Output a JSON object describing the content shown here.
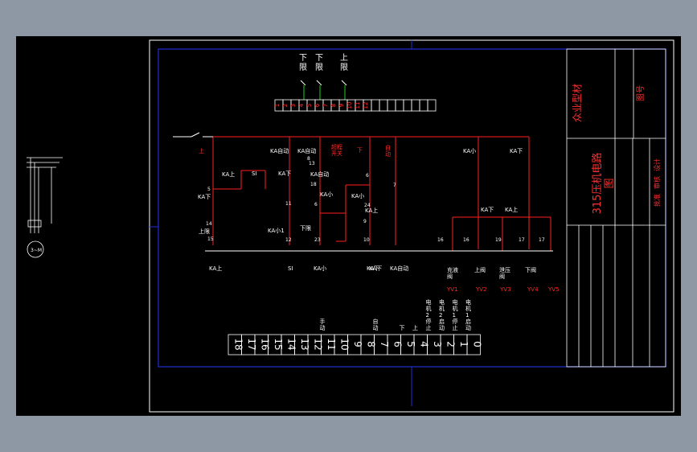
{
  "colors": {
    "background": "#8e97a4",
    "canvas": "#000000",
    "frame": "#ffffff",
    "border": "#1f2fd6",
    "wire": "#ff2020",
    "text": "#ffffff",
    "terminal_num": "#ff3030",
    "label_red": "#ff2a2a"
  },
  "top_switches": [
    {
      "label": "下\n限"
    },
    {
      "label": "下\n限"
    },
    {
      "label": "上\n限"
    }
  ],
  "top_terminals": [
    "1",
    "2",
    "3",
    "4",
    "5",
    "6",
    "7",
    "8",
    "9",
    "10",
    "11",
    "12",
    "",
    "",
    "",
    "",
    "",
    "",
    "",
    ""
  ],
  "bottom_terminals": [
    "18",
    "17",
    "16",
    "15",
    "14",
    "13",
    "12",
    "11",
    "10",
    "9",
    "8",
    "7",
    "6",
    "5",
    "4",
    "3",
    "2",
    "1",
    "0"
  ],
  "bottom_terminal_labels": [
    {
      "text": "手\n动",
      "slot": 11
    },
    {
      "text": "自\n动",
      "slot": 7
    },
    {
      "text": "下",
      "slot": 5
    },
    {
      "text": "上",
      "slot": 4
    },
    {
      "text": "电\n机\n2\n停\n止",
      "slot": 3
    },
    {
      "text": "电\n机\n2\n启\n动",
      "slot": 2
    },
    {
      "text": "电\n机\n1\n停\n止",
      "slot": 1
    },
    {
      "text": "电\n机\n1\n启\n动",
      "slot": 0
    }
  ],
  "circuit_labels": [
    "上",
    "KA上",
    "SI",
    "KA下",
    "上限",
    "KA自动",
    "KA自动",
    "KA下",
    "KA小1",
    "下限",
    "KA小",
    "KA上",
    "KA小",
    "KA自动",
    "下",
    "自\n动",
    "KA下",
    "KA小",
    "KA下",
    "KA上",
    "KA下",
    "KA上",
    "SI",
    "KA小",
    "KA下",
    "KA自动",
    "充液\n阀",
    "上阀",
    "泄压\n阀",
    "下阀",
    "超程\n开关",
    "YV1",
    "YV2",
    "YV3",
    "YV4",
    "YV5"
  ],
  "wire_numbers": [
    "5",
    "14",
    "15",
    "8",
    "11",
    "12",
    "13",
    "18",
    "6",
    "23",
    "6",
    "24",
    "9",
    "10",
    "7",
    "16",
    "16",
    "19",
    "17",
    "17"
  ],
  "title_block": {
    "company": "众业型材",
    "drawing_title": "315压机电路\n图",
    "doc_no": "图号",
    "rows": [
      "设计",
      "审核",
      "批准"
    ]
  }
}
